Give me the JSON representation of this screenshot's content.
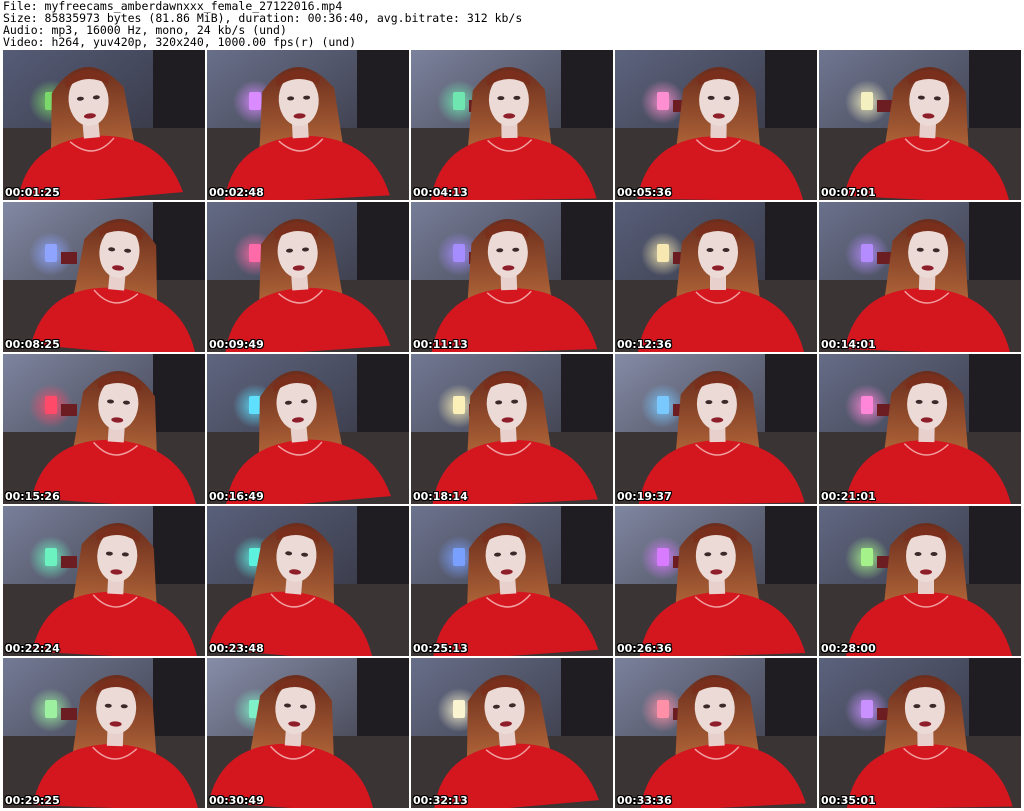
{
  "header": {
    "line1": "File: myfreecams_amberdawnxxx_female_27122016.mp4",
    "line2": "Size: 85835973 bytes (81.86 MiB), duration: 00:36:40, avg.bitrate: 312 kb/s",
    "line3": "Audio: mp3, 16000 Hz, mono, 24 kb/s (und)",
    "line4": "Video: h264, yuv420p, 320x240, 1000.00 fps(r) (und)"
  },
  "thumbnails": [
    {
      "time": "00:01:25",
      "lamp": "#7bd86a"
    },
    {
      "time": "00:02:48",
      "lamp": "#d98bff"
    },
    {
      "time": "00:04:13",
      "lamp": "#6fe6b0"
    },
    {
      "time": "00:05:36",
      "lamp": "#ff8fd0"
    },
    {
      "time": "00:07:01",
      "lamp": "#f4f0c0"
    },
    {
      "time": "00:08:25",
      "lamp": "#8ea4ff"
    },
    {
      "time": "00:09:49",
      "lamp": "#ff6aa8"
    },
    {
      "time": "00:11:13",
      "lamp": "#a58cff"
    },
    {
      "time": "00:12:36",
      "lamp": "#f6e8b0"
    },
    {
      "time": "00:14:01",
      "lamp": "#b48cff"
    },
    {
      "time": "00:15:26",
      "lamp": "#ff4a6a"
    },
    {
      "time": "00:16:49",
      "lamp": "#5fe0ff"
    },
    {
      "time": "00:18:14",
      "lamp": "#fbf0b8"
    },
    {
      "time": "00:19:37",
      "lamp": "#79c9ff"
    },
    {
      "time": "00:21:01",
      "lamp": "#ff86d8"
    },
    {
      "time": "00:22:24",
      "lamp": "#6cf2c0"
    },
    {
      "time": "00:23:48",
      "lamp": "#5df2e0"
    },
    {
      "time": "00:25:13",
      "lamp": "#7aa0ff"
    },
    {
      "time": "00:26:36",
      "lamp": "#d87bff"
    },
    {
      "time": "00:28:00",
      "lamp": "#a6f28a"
    },
    {
      "time": "00:29:25",
      "lamp": "#9df0a0"
    },
    {
      "time": "00:30:49",
      "lamp": "#7ff0c8"
    },
    {
      "time": "00:32:13",
      "lamp": "#fbf4d0"
    },
    {
      "time": "00:33:36",
      "lamp": "#ff90a8"
    },
    {
      "time": "00:35:01",
      "lamp": "#c990ff"
    }
  ]
}
